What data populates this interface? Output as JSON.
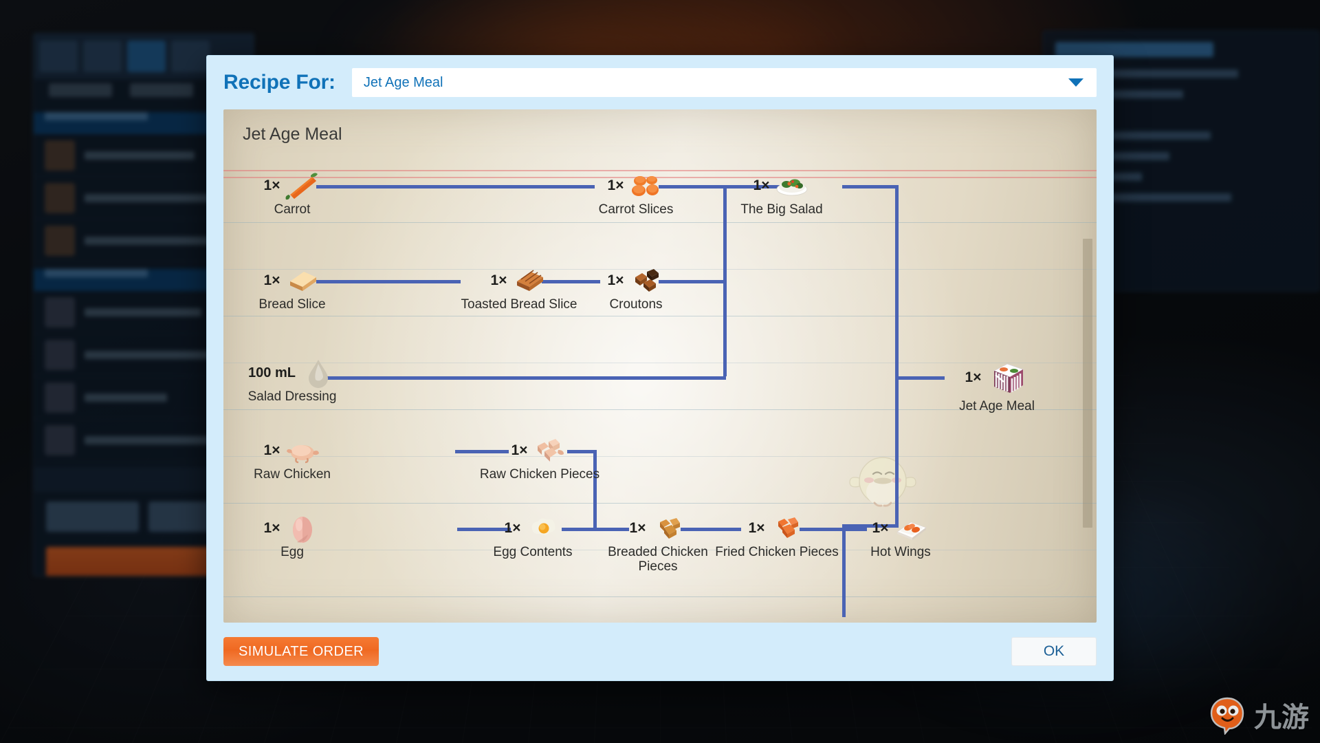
{
  "dialog": {
    "recipe_for_label": "Recipe For:",
    "selected_recipe": "Jet Age Meal",
    "dropdown_icon": "chevron-down-icon",
    "recipe_title": "Jet Age Meal",
    "simulate_label": "SIMULATE ORDER",
    "ok_label": "OK"
  },
  "colors": {
    "dialog_bg": "#d3ecfb",
    "accent_blue": "#1072b8",
    "connector_blue": "#4a63b4",
    "simulate_orange": "#ef6922",
    "paper": "#e5ddc9"
  },
  "graph": {
    "nodes": [
      {
        "id": "carrot",
        "qty": "1×",
        "label": "Carrot",
        "icon": "carrot-icon"
      },
      {
        "id": "carrot-slices",
        "qty": "1×",
        "label": "Carrot Slices",
        "icon": "carrot-slices-icon"
      },
      {
        "id": "the-big-salad",
        "qty": "1×",
        "label": "The Big Salad",
        "icon": "salad-bowl-icon"
      },
      {
        "id": "bread-slice",
        "qty": "1×",
        "label": "Bread Slice",
        "icon": "bread-slice-icon"
      },
      {
        "id": "toasted-bread",
        "qty": "1×",
        "label": "Toasted Bread Slice",
        "icon": "toasted-bread-icon"
      },
      {
        "id": "croutons",
        "qty": "1×",
        "label": "Croutons",
        "icon": "croutons-icon"
      },
      {
        "id": "salad-dressing",
        "qty": "100 mL",
        "label": "Salad Dressing",
        "icon": "droplet-icon"
      },
      {
        "id": "jet-age-meal",
        "qty": "1×",
        "label": "Jet Age Meal",
        "icon": "meal-box-icon"
      },
      {
        "id": "raw-chicken",
        "qty": "1×",
        "label": "Raw Chicken",
        "icon": "raw-chicken-icon"
      },
      {
        "id": "raw-chicken-pcs",
        "qty": "1×",
        "label": "Raw Chicken Pieces",
        "icon": "raw-chicken-pieces-icon"
      },
      {
        "id": "egg",
        "qty": "1×",
        "label": "Egg",
        "icon": "egg-icon"
      },
      {
        "id": "egg-contents",
        "qty": "1×",
        "label": "Egg Contents",
        "icon": "egg-contents-icon"
      },
      {
        "id": "breaded-chicken",
        "qty": "1×",
        "label": "Breaded Chicken Pieces",
        "icon": "breaded-chicken-icon"
      },
      {
        "id": "fried-chicken",
        "qty": "1×",
        "label": "Fried Chicken Pieces",
        "icon": "fried-chicken-icon"
      },
      {
        "id": "hot-wings",
        "qty": "1×",
        "label": "Hot Wings",
        "icon": "hot-wings-icon"
      }
    ],
    "edges": [
      "carrot -> carrot-slices",
      "carrot-slices -> the-big-salad",
      "bread-slice -> toasted-bread",
      "toasted-bread -> croutons",
      "croutons -> the-big-salad",
      "salad-dressing -> the-big-salad",
      "the-big-salad -> jet-age-meal",
      "raw-chicken -> raw-chicken-pcs",
      "raw-chicken-pcs -> breaded-chicken",
      "egg -> egg-contents",
      "egg-contents -> breaded-chicken",
      "breaded-chicken -> fried-chicken",
      "fried-chicken -> hot-wings",
      "hot-wings -> jet-age-meal"
    ]
  },
  "watermark": {
    "text": "九游",
    "logo": "mascot-logo-icon"
  }
}
